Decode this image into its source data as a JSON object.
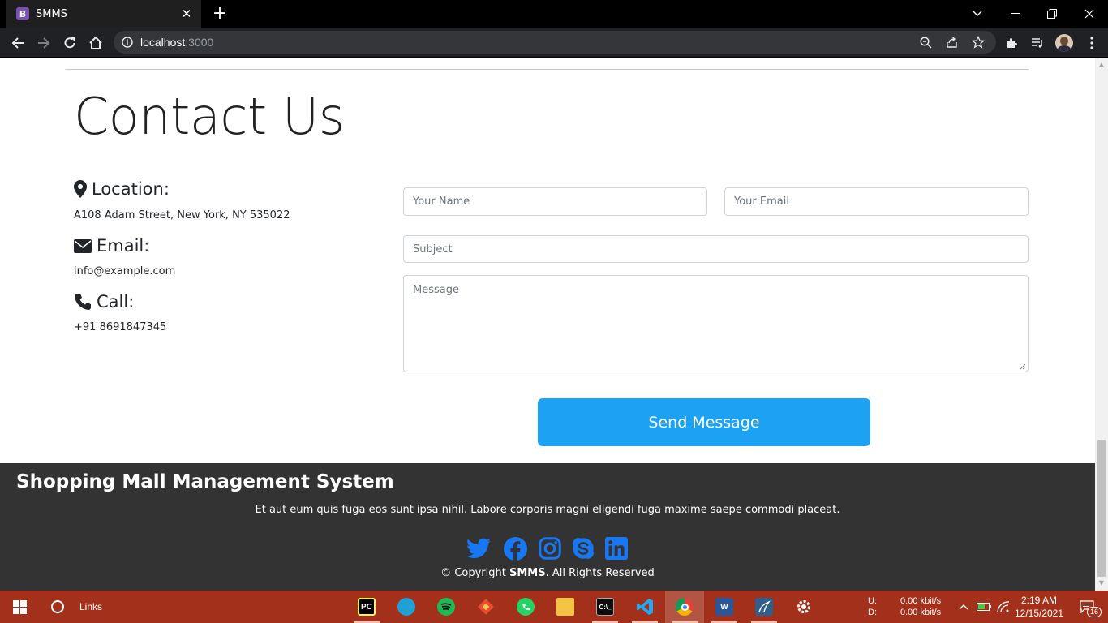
{
  "browser": {
    "tab_title": "SMMS",
    "tab_favicon": "B",
    "url_host": "localhost",
    "url_port": ":3000"
  },
  "page": {
    "title": "Contact Us",
    "location": {
      "label": "Location:",
      "value": "A108 Adam Street, New York, NY 535022",
      "icon": "map-marker-icon"
    },
    "email": {
      "label": "Email:",
      "value": "info@example.com",
      "icon": "envelope-icon"
    },
    "call": {
      "label": "Call:",
      "value": "+91 8691847345",
      "icon": "phone-icon"
    },
    "form": {
      "name_placeholder": "Your Name",
      "email_placeholder": "Your Email",
      "subject_placeholder": "Subject",
      "message_placeholder": "Message",
      "send_label": "Send Message"
    }
  },
  "footer": {
    "title": "Shopping Mall Management System",
    "text": "Et aut eum quis fuga eos sunt ipsa nihil. Labore corporis magni eligendi fuga maxime saepe commodi placeat.",
    "copyright_prefix": "© Copyright",
    "copyright_brand": "SMMS",
    "copyright_suffix": ". All Rights Reserved",
    "social": [
      "twitter-icon",
      "facebook-icon",
      "instagram-icon",
      "skype-icon",
      "linkedin-icon"
    ],
    "accent": "#1877f2"
  },
  "taskbar": {
    "search_label": "Links",
    "net_up_label": "U:",
    "net_down_label": "D:",
    "net_up": "0.00 kbit/s",
    "net_down": "0.00 kbit/s",
    "time": "2:19 AM",
    "date": "12/15/2021",
    "notifications": "16",
    "color": "#a2301a"
  }
}
